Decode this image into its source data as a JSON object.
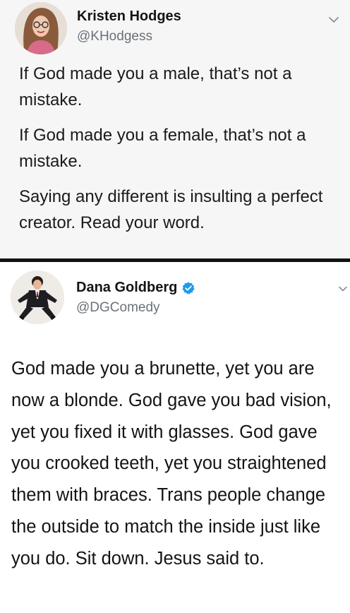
{
  "tweet1": {
    "author_name": "Kristen Hodges",
    "author_handle": "@KHodgess",
    "avatar_icon": "user-photo-avatar",
    "menu_icon": "chevron-down-icon",
    "paragraphs": [
      "If God made you a male, that’s not a mistake.",
      "If God made you a female, that’s not a mistake.",
      "Saying any different is insulting a perfect creator. Read your word."
    ],
    "background_color": "#f6f6f6"
  },
  "tweet2": {
    "author_name": "Dana Goldberg",
    "author_handle": "@DGComedy",
    "verified_icon": "verified-badge-icon",
    "verified_color": "#1d9bf0",
    "avatar_icon": "user-photo-avatar",
    "menu_icon": "chevron-down-icon",
    "text": "God made you a brunette, yet you are now a blonde. God gave you bad vision, yet you fixed it with glasses. God gave you crooked teeth, yet you straightened them with braces. Trans people change the outside to match the inside just like you do. Sit down. Jesus said to."
  }
}
